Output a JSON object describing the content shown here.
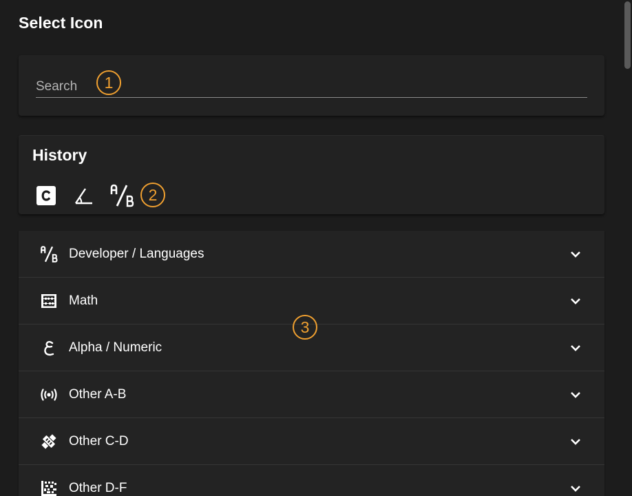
{
  "dialog": {
    "title": "Select Icon"
  },
  "search": {
    "placeholder": "Search",
    "value": ""
  },
  "history": {
    "title": "History",
    "icons": [
      "language-c-icon",
      "angle-acute-icon",
      "alpha-a-slash-b-icon"
    ]
  },
  "categories": [
    {
      "label": "Developer / Languages",
      "icon": "alpha-a-slash-b-icon"
    },
    {
      "label": "Math",
      "icon": "abacus-icon"
    },
    {
      "label": "Alpha / Numeric",
      "icon": "arabic-ain-icon"
    },
    {
      "label": "Other A-B",
      "icon": "broadcast-icon"
    },
    {
      "label": "Other C-D",
      "icon": "satellite-dish-icon"
    },
    {
      "label": "Other D-F",
      "icon": "data-matrix-icon"
    }
  ],
  "callouts": [
    "1",
    "2",
    "3"
  ],
  "colors": {
    "background": "#1c1c1c",
    "card": "#222222",
    "callout_accent": "#f0a030",
    "text": "#ffffff"
  }
}
